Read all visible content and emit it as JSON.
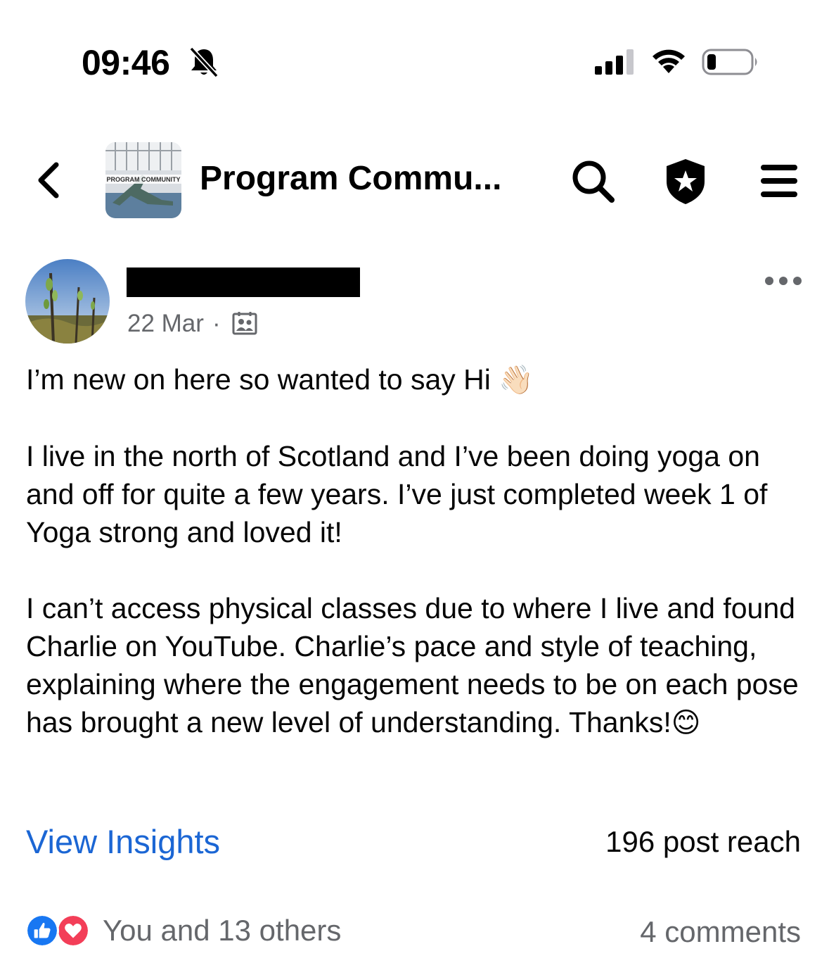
{
  "status_bar": {
    "time": "09:46",
    "icons": [
      "bell-slash-icon",
      "cellular-signal-icon",
      "wifi-icon",
      "battery-icon"
    ]
  },
  "header": {
    "group_title": "Program Commu...",
    "group_thumbnail_text": "PROGRAM COMMUNITY",
    "icons": [
      "back-chevron-icon",
      "search-icon",
      "admin-shield-icon",
      "menu-icon"
    ]
  },
  "post": {
    "date": "22 Mar",
    "separator": "·",
    "audience_icon": "group-members-icon",
    "paragraphs": [
      "I’m new on here so wanted to say Hi",
      "I live in the north of Scotland and I’ve been doing yoga on and off for quite a few years. I’ve just completed week 1 of Yoga strong and loved it!",
      "I can’t access physical classes due to where I live and found Charlie on YouTube. Charlie’s pace and style of teaching, explaining where the engagement needs to be on each pose has brought a new level of understanding. Thanks!"
    ],
    "emoji_wave": "👋🏻",
    "emoji_smile": "😊"
  },
  "insights": {
    "link_label": "View Insights",
    "reach": "196 post reach"
  },
  "reactions": {
    "summary": "You and 13 others",
    "comments": "4 comments",
    "icons": [
      "like-reaction-icon",
      "love-reaction-icon"
    ]
  },
  "colors": {
    "link_blue": "#1b66d4",
    "meta_gray": "#65676b",
    "like_blue": "#1877f2",
    "love_red": "#f33e58"
  }
}
